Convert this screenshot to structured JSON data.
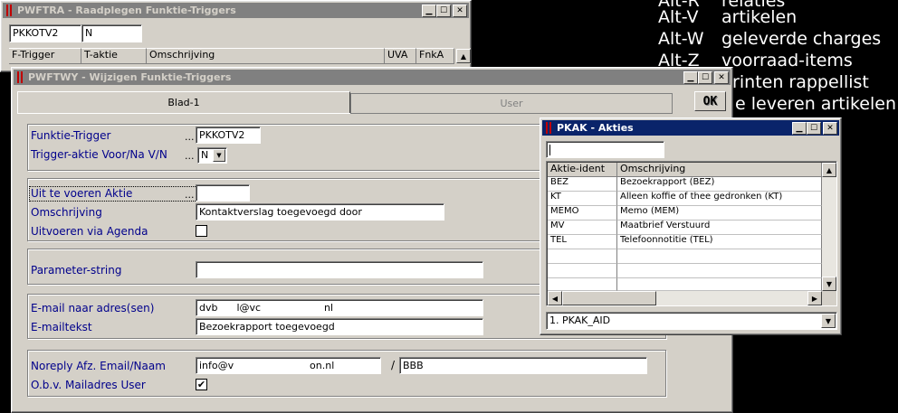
{
  "background_shortcuts": [
    {
      "key": "Alt-R",
      "label": "relaties"
    },
    {
      "key": "Alt-V",
      "label": "artikelen"
    },
    {
      "key": "Alt-W",
      "label": "geleverde charges"
    },
    {
      "key": "Alt-Z",
      "label": "voorraad-items"
    },
    {
      "key": "",
      "label": "printen rappellist"
    },
    {
      "key": "",
      "label": "e leveren artikelen"
    }
  ],
  "window_raadplegen": {
    "title": "PWFTRA - Raadplegen Funktie-Triggers",
    "field_trigger": "PKKOTV2",
    "field_aktie": "N",
    "columns": [
      "F-Trigger",
      "T-aktie",
      "Omschrijving",
      "UVA",
      "FnkA"
    ]
  },
  "window_wijzigen": {
    "title": "PWFTWY - Wijzigen Funktie-Triggers",
    "tabs": [
      "Blad-1",
      "User"
    ],
    "ok_label": "OK",
    "dots": "...",
    "funktie_trigger": {
      "label": "Funktie-Trigger",
      "value": "PKKOTV2"
    },
    "trigger_aktie": {
      "label": "Trigger-aktie Voor/Na V/N",
      "value": "N"
    },
    "uit_te_voeren": {
      "label": "Uit te voeren Aktie",
      "value": ""
    },
    "omschrijving": {
      "label": "Omschrijving",
      "value": "Kontaktverslag toegevoegd door"
    },
    "uitvoeren_agenda": {
      "label": "Uitvoeren via Agenda",
      "checked": false
    },
    "parameter": {
      "label": "Parameter-string",
      "value": ""
    },
    "email_adres": {
      "label": "E-mail naar adres(sen)",
      "value": "dvb      l@vc                    nl"
    },
    "emailtekst": {
      "label": "E-mailtekst",
      "value": "Bezoekrapport toegevoegd"
    },
    "noreply": {
      "label": "Noreply Afz. Email/Naam",
      "email": "info@v                        on.nl",
      "separator": "/",
      "naam": "BBB"
    },
    "obv_mailadres": {
      "label": "O.b.v. Mailadres User",
      "checked": true
    }
  },
  "window_akties": {
    "title": "PKAK - Akties",
    "search_value": "",
    "columns": [
      "Aktie-ident",
      "Omschrijving"
    ],
    "rows": [
      [
        "BEZ",
        "Bezoekrapport (BEZ)"
      ],
      [
        "KT",
        "Alleen koffie of thee gedronken (KT)"
      ],
      [
        "MEMO",
        "Memo (MEM)"
      ],
      [
        "MV",
        "Maatbrief Verstuurd"
      ],
      [
        "TEL",
        "Telefoonnotitie (TEL)"
      ]
    ],
    "sort_select": "1. PKAK_AID"
  },
  "colors": {
    "title_active": "#0a246a",
    "title_inactive": "#808080",
    "label_blue": "#00008b",
    "face": "#d4d0c8"
  }
}
